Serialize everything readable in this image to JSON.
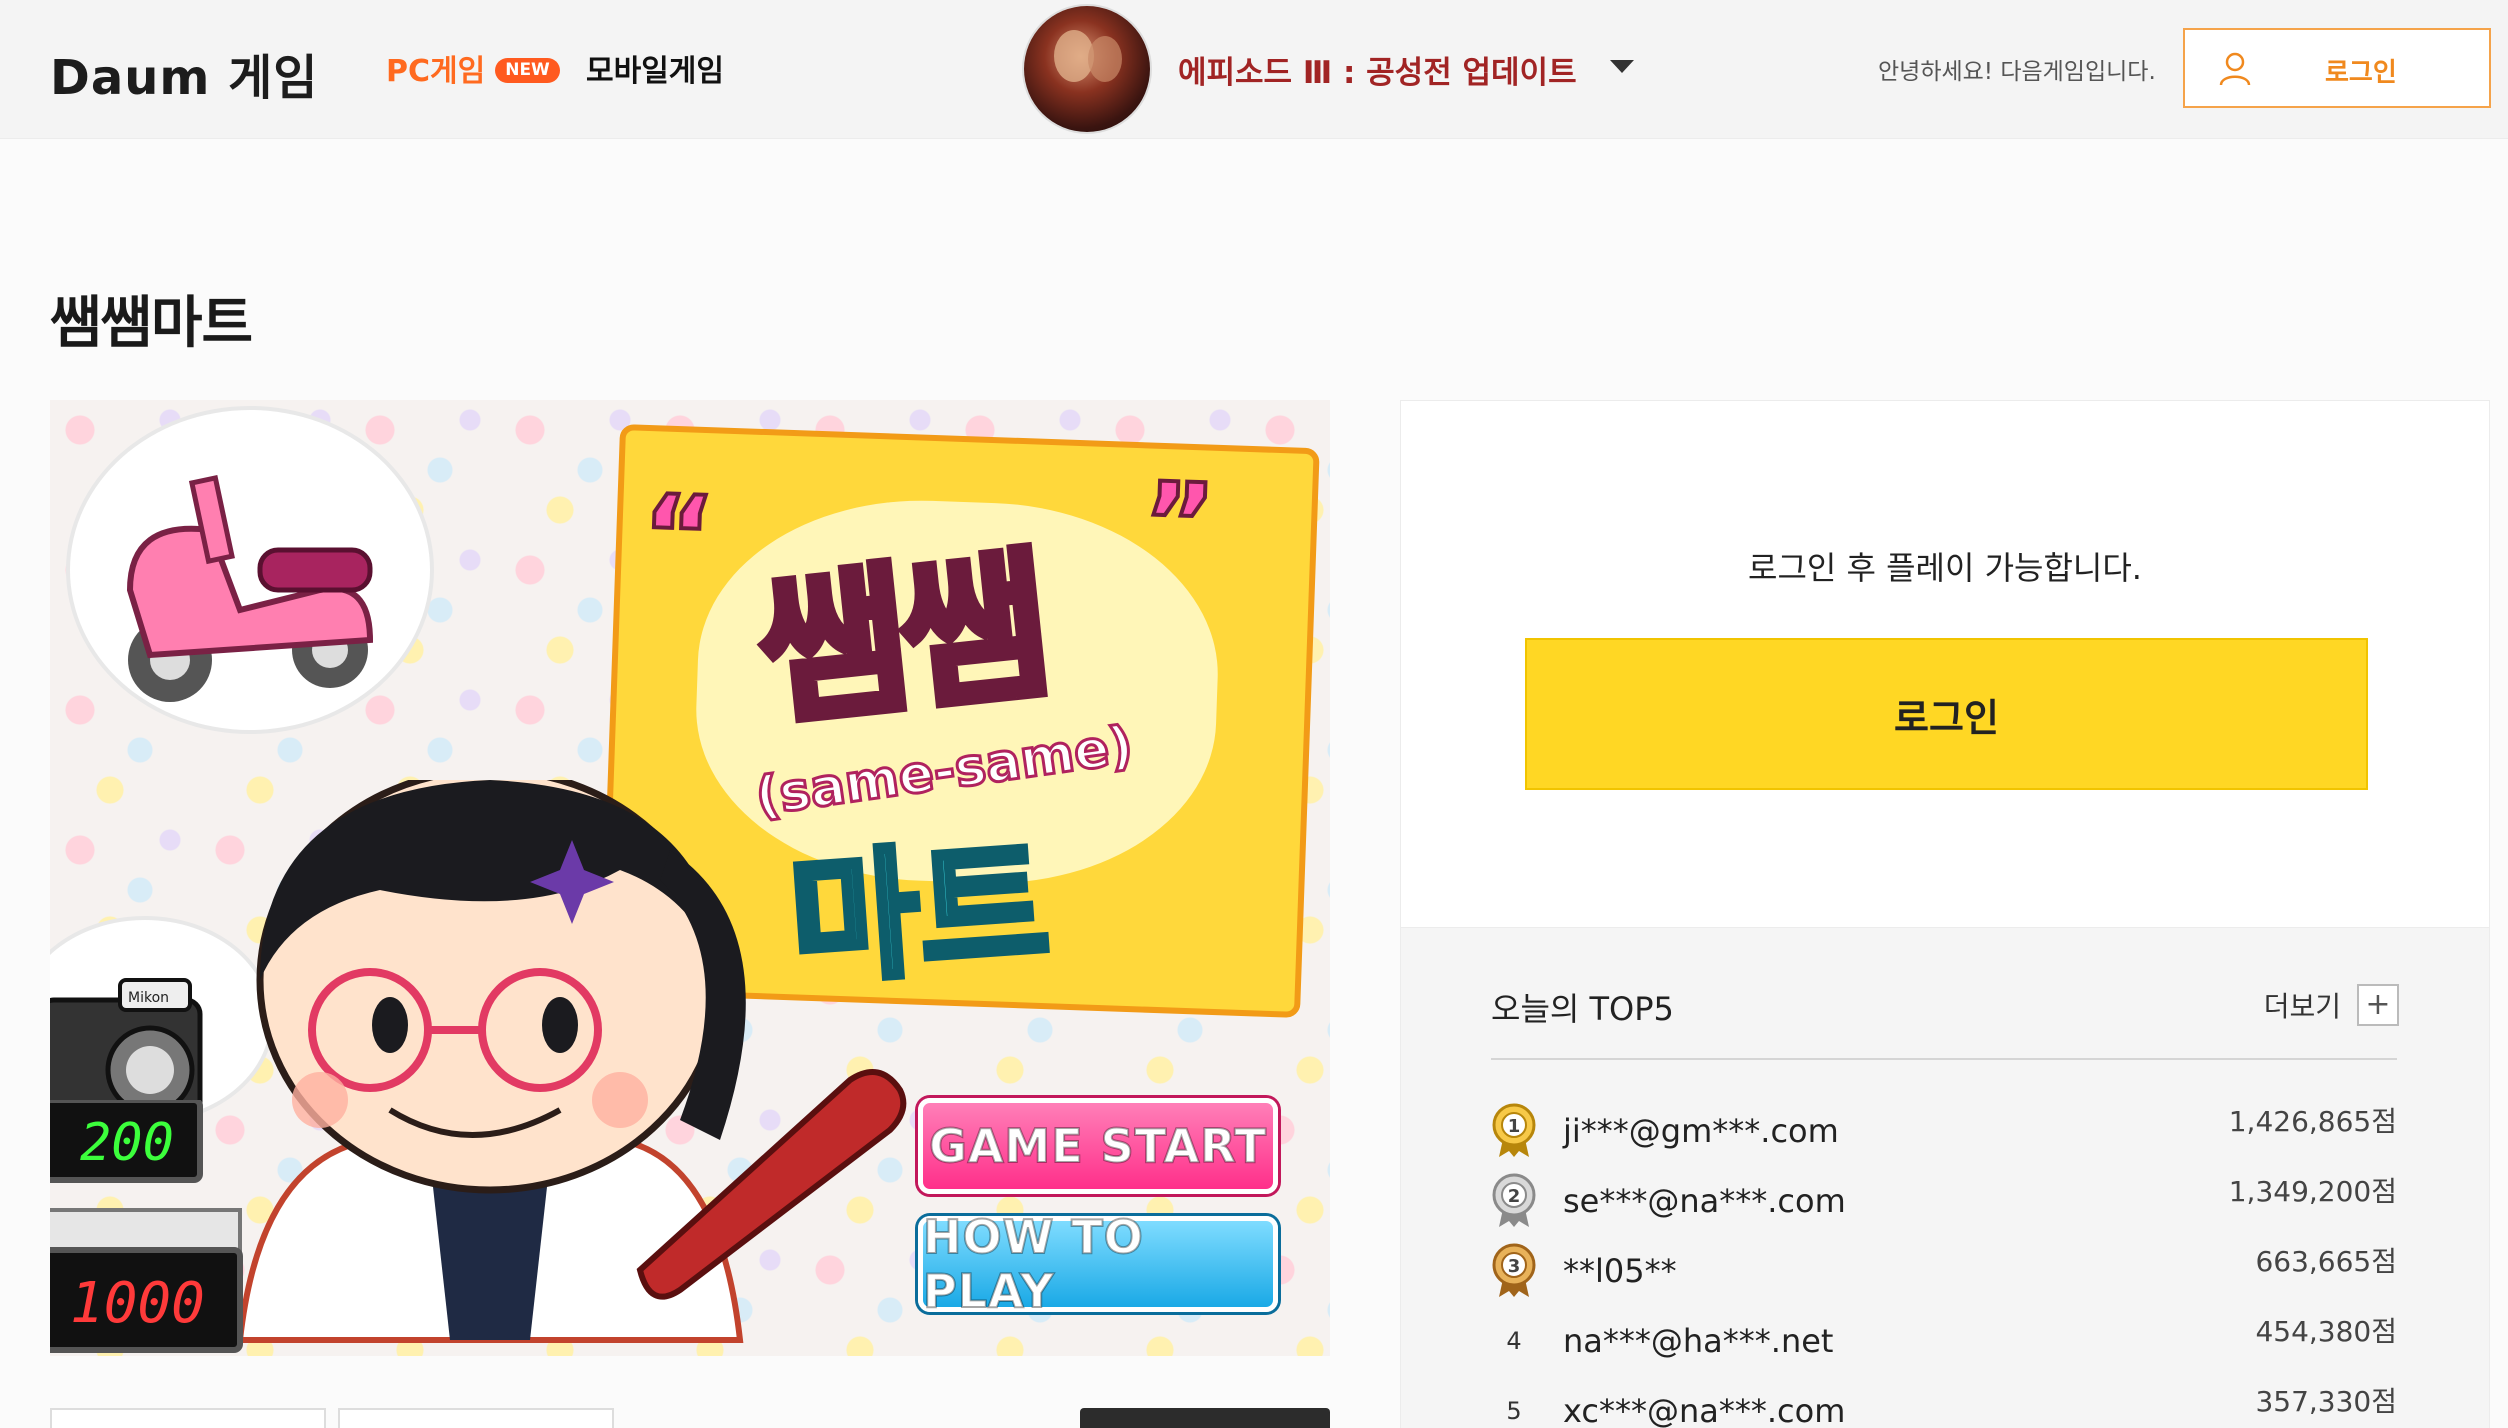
{
  "header": {
    "logo": "Daum 게임",
    "nav_pc": "PC게임",
    "nav_pc_badge": "NEW",
    "nav_mobile": "모바일게임",
    "episode_text": "에피소드 Ⅲ : 공성전 업데이트",
    "greeting": "안녕하세요! 다음게임입니다.",
    "login_label": "로그인"
  },
  "page": {
    "title": "쌤쌤마트"
  },
  "banner": {
    "title_main": "쌤쌤",
    "title_sub": "(same-same)",
    "title_mart": "마트",
    "register_top": "200",
    "register_bottom": "1000",
    "game_start": "GAME START",
    "how_to_play": "HOW TO PLAY",
    "camera_brand": "Mikon"
  },
  "login_panel": {
    "message": "로그인 후 플레이 가능합니다.",
    "button": "로그인"
  },
  "ranking": {
    "title": "오늘의 TOP5",
    "more": "더보기",
    "more_icon": "+",
    "items": [
      {
        "rank": "1",
        "name": "ji***@gm***.com",
        "score": "1,426,865점",
        "medal": "gold"
      },
      {
        "rank": "2",
        "name": "se***@na***.com",
        "score": "1,349,200점",
        "medal": "silver"
      },
      {
        "rank": "3",
        "name": "**l05**",
        "score": "663,665점",
        "medal": "bronze"
      },
      {
        "rank": "4",
        "name": "na***@ha***.net",
        "score": "454,380점",
        "medal": "none"
      },
      {
        "rank": "5",
        "name": "xc***@na***.com",
        "score": "357,330점",
        "medal": "none"
      }
    ]
  },
  "colors": {
    "accent_orange": "#ff6a1f",
    "login_yellow": "#ffd724",
    "episode_red": "#a12424"
  }
}
